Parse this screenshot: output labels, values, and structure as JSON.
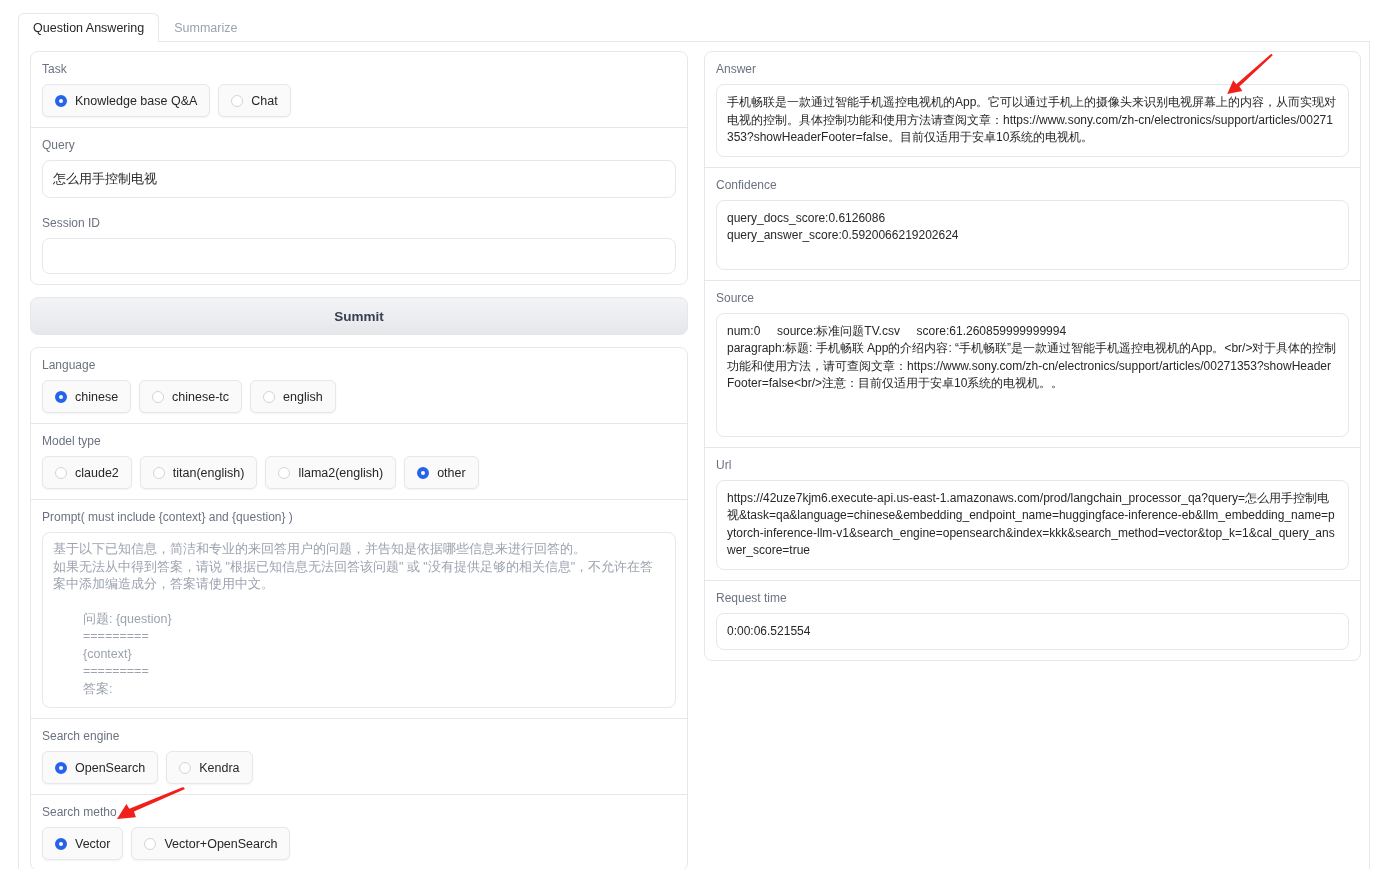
{
  "tabs": [
    {
      "label": "Question Answering",
      "selected": true
    },
    {
      "label": "Summarize",
      "selected": false
    }
  ],
  "left": {
    "task": {
      "label": "Task",
      "options": [
        {
          "label": "Knowledge base Q&A",
          "selected": true
        },
        {
          "label": "Chat",
          "selected": false
        }
      ]
    },
    "query": {
      "label": "Query",
      "value": "怎么用手控制电视"
    },
    "session_id": {
      "label": "Session ID"
    },
    "submit_button": "Summit",
    "language": {
      "label": "Language",
      "options": [
        {
          "label": "chinese",
          "selected": true
        },
        {
          "label": "chinese-tc",
          "selected": false
        },
        {
          "label": "english",
          "selected": false
        }
      ]
    },
    "model_type": {
      "label": "Model type",
      "options": [
        {
          "label": "claude2",
          "selected": false
        },
        {
          "label": "titan(english)",
          "selected": false
        },
        {
          "label": "llama2(english)",
          "selected": false
        },
        {
          "label": "other",
          "selected": true
        }
      ]
    },
    "prompt": {
      "label": "Prompt( must include {context} and {question} )",
      "placeholder_lines": [
        {
          "text": "基于以下已知信息，简洁和专业的来回答用户的问题，并告知是依据哪些信息来进行回答的。",
          "indented": false
        },
        {
          "text": "如果无法从中得到答案，请说 \"根据已知信息无法回答该问题\" 或 \"没有提供足够的相关信息\"，不允许在答案中添加编造成分，答案请使用中文。",
          "indented": false
        },
        {
          "text": "问题: {question}",
          "indented": true
        },
        {
          "text": "=========",
          "indented": true
        },
        {
          "text": "{context}",
          "indented": true
        },
        {
          "text": "=========",
          "indented": true
        },
        {
          "text": "答案:",
          "indented": true
        }
      ]
    },
    "search_engine": {
      "label": "Search engine",
      "options": [
        {
          "label": "OpenSearch",
          "selected": true
        },
        {
          "label": "Kendra",
          "selected": false
        }
      ]
    },
    "search_method": {
      "label": "Search metho",
      "options": [
        {
          "label": "Vector",
          "selected": true
        },
        {
          "label": "Vector+OpenSearch",
          "selected": false
        }
      ]
    }
  },
  "right": {
    "answer": {
      "label": "Answer",
      "value": "手机畅联是一款通过智能手机遥控电视机的App。它可以通过手机上的摄像头来识别电视屏幕上的内容，从而实现对电视的控制。具体控制功能和使用方法请查阅文章：https://www.sony.com/zh-cn/electronics/support/articles/00271353?showHeaderFooter=false。目前仅适用于安卓10系统的电视机。"
    },
    "confidence": {
      "label": "Confidence",
      "value": "query_docs_score:0.6126086\nquery_answer_score:0.5920066219202624"
    },
    "source": {
      "label": "Source",
      "value": "num:0     source:标准问题TV.csv     score:61.260859999999994\nparagraph:标题: 手机畅联 App的介绍内容: “手机畅联”是一款通过智能手机遥控电视机的App。<br/>对于具体的控制功能和使用方法，请可查阅文章：https://www.sony.com/zh-cn/electronics/support/articles/00271353?showHeaderFooter=false<br/>注意：目前仅适用于安卓10系统的电视机。。"
    },
    "url": {
      "label": "Url",
      "value": "https://42uze7kjm6.execute-api.us-east-1.amazonaws.com/prod/langchain_processor_qa?query=怎么用手控制电视&task=qa&language=chinese&embedding_endpoint_name=huggingface-inference-eb&llm_embedding_name=pytorch-inference-llm-v1&search_engine=opensearch&index=kkk&search_method=vector&top_k=1&cal_query_answer_score=true"
    },
    "request_time": {
      "label": "Request time",
      "value": "0:00:06.521554"
    }
  }
}
